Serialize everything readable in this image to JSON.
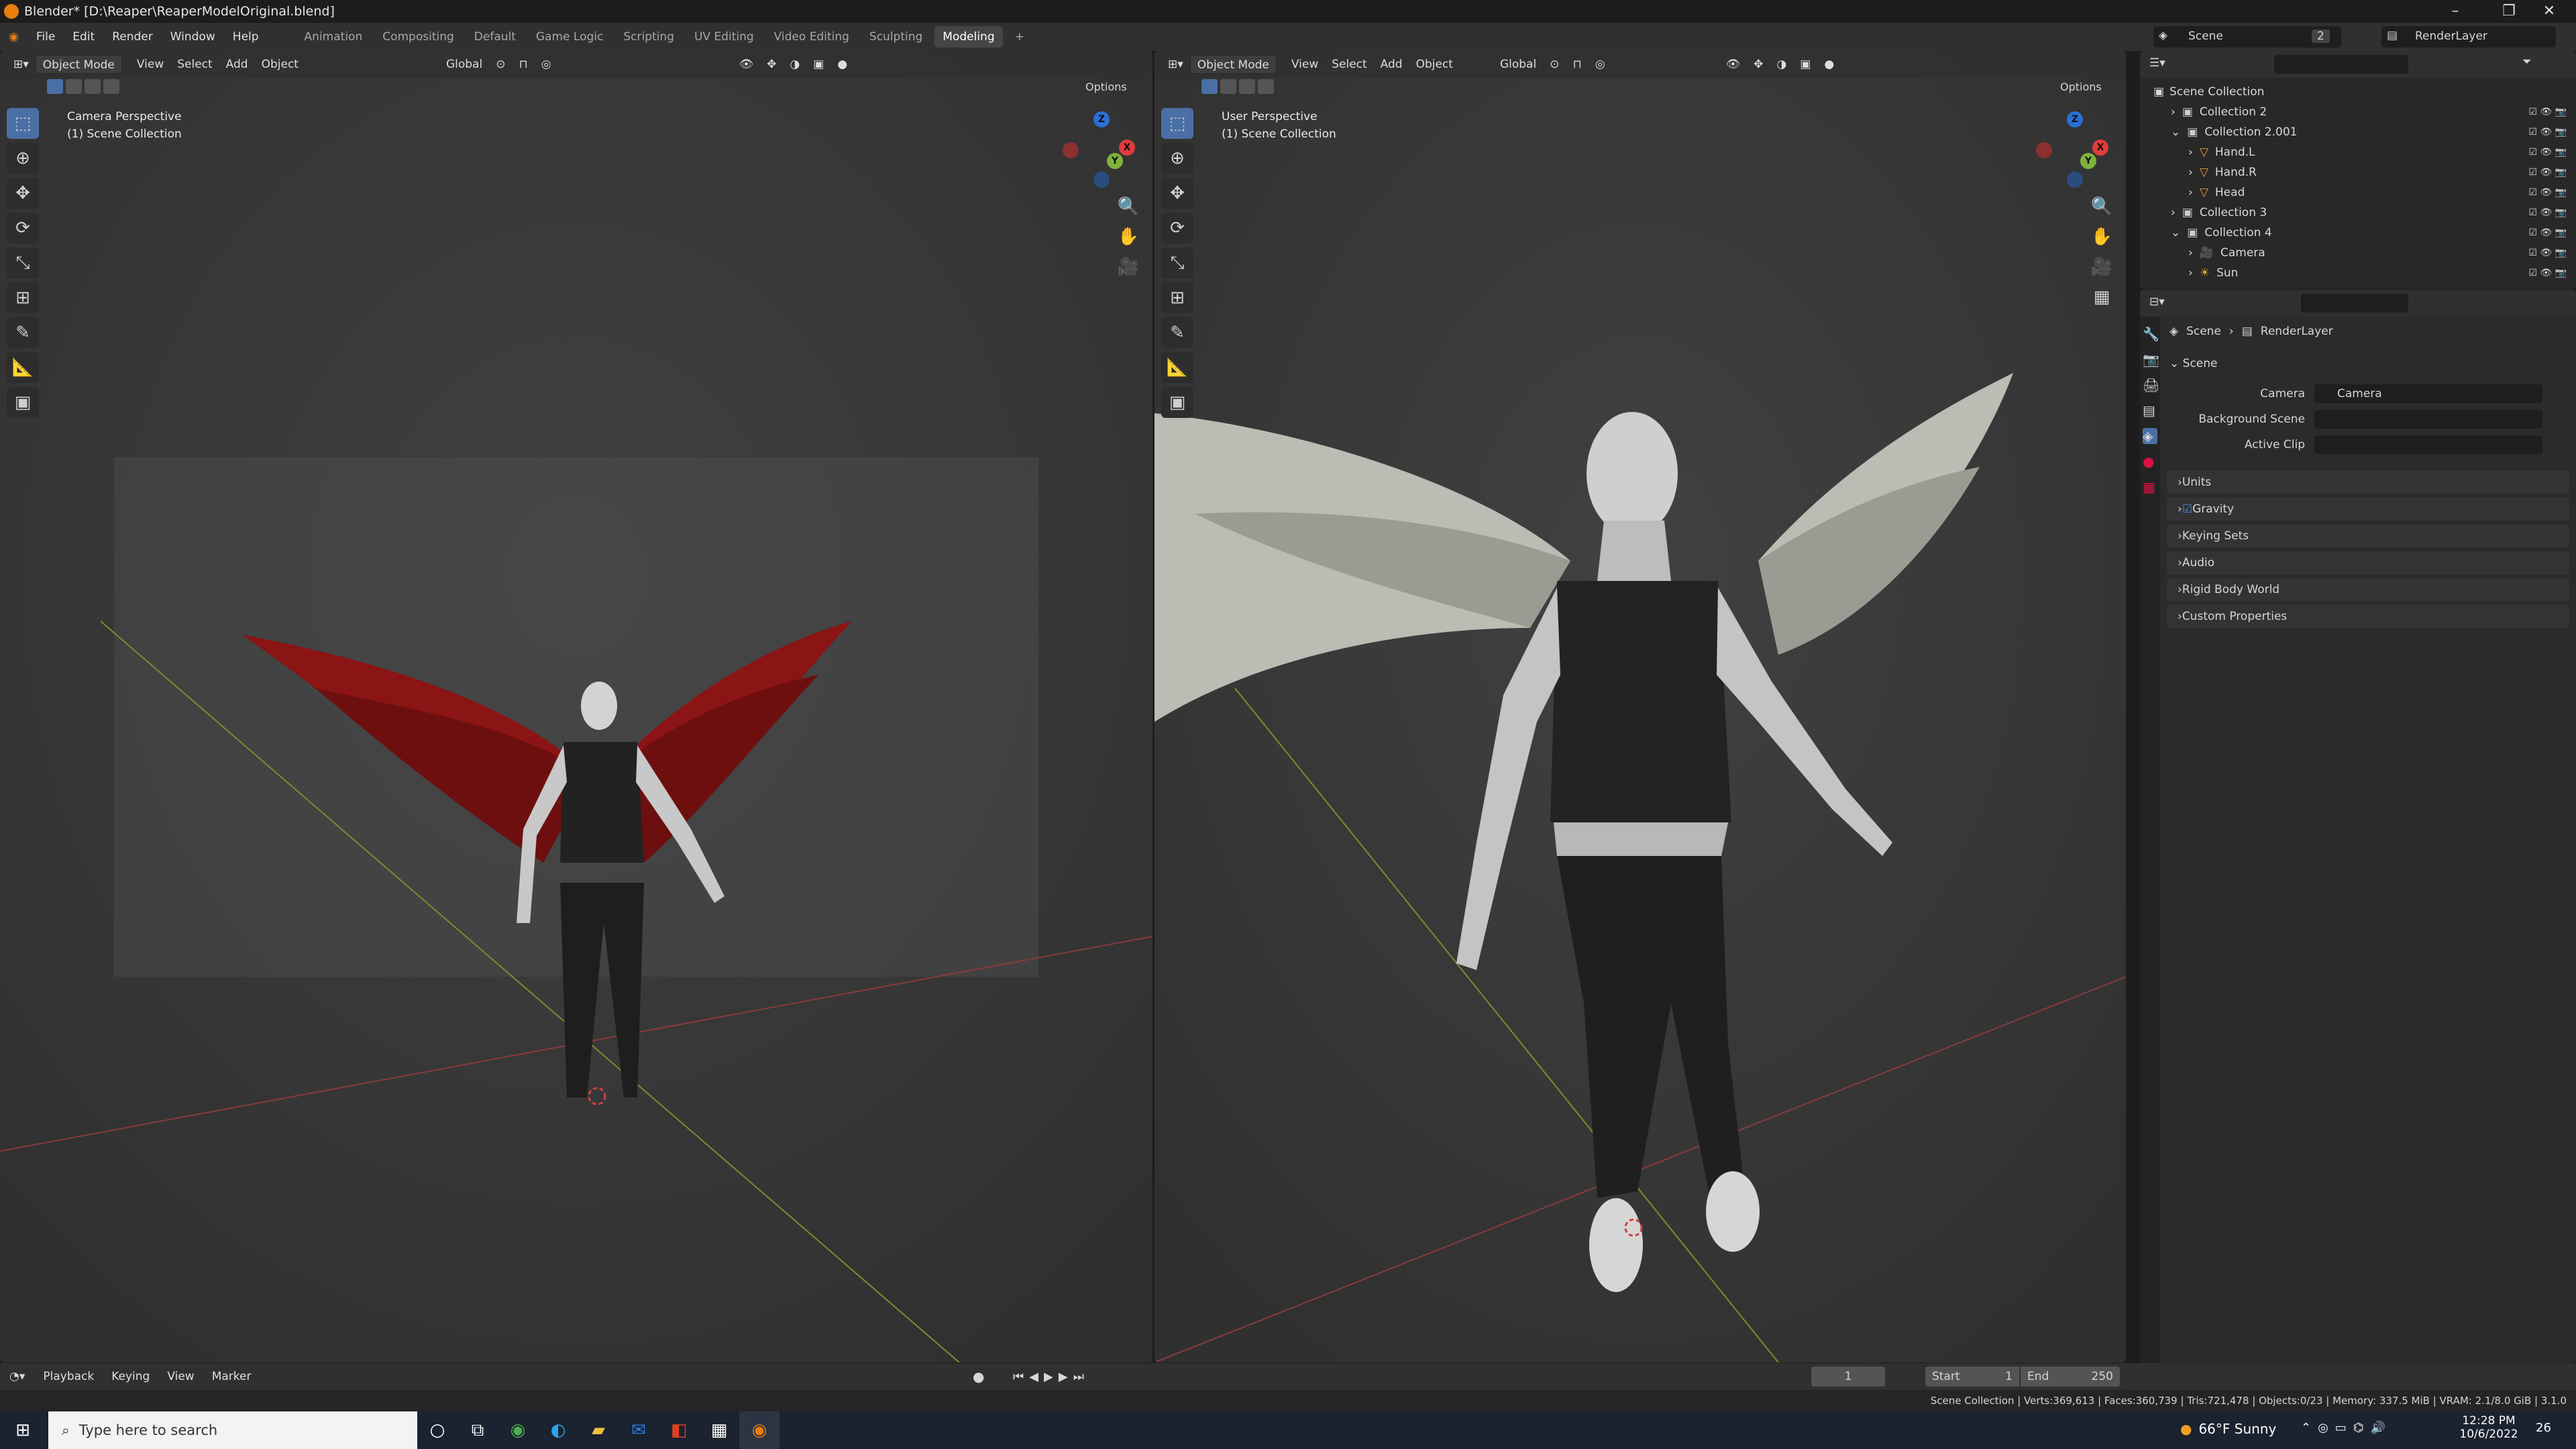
{
  "window": {
    "title": "Blender* [D:\\Reaper\\ReaperModelOriginal.blend]"
  },
  "menus": [
    "File",
    "Edit",
    "Render",
    "Window",
    "Help"
  ],
  "workspaces": [
    "Animation",
    "Compositing",
    "Default",
    "Game Logic",
    "Scripting",
    "UV Editing",
    "Video Editing",
    "Sculpting",
    "Modeling"
  ],
  "active_workspace": "Modeling",
  "scene_selector": {
    "value": "Scene",
    "count": "2"
  },
  "layer_selector": {
    "value": "RenderLayer"
  },
  "viewport_left": {
    "mode": "Object Mode",
    "menus": [
      "View",
      "Select",
      "Add",
      "Object"
    ],
    "orientation": "Global",
    "options": "Options",
    "title": "Camera Perspective",
    "subtitle": "(1) Scene Collection"
  },
  "viewport_right": {
    "mode": "Object Mode",
    "menus": [
      "View",
      "Select",
      "Add",
      "Object"
    ],
    "orientation": "Global",
    "options": "Options",
    "title": "User Perspective",
    "subtitle": "(1) Scene Collection"
  },
  "outliner": {
    "root": "Scene Collection",
    "items": [
      {
        "label": "Collection 2",
        "depth": 1,
        "expanded": false
      },
      {
        "label": "Collection 2.001",
        "depth": 1,
        "expanded": true
      },
      {
        "label": "Hand.L",
        "depth": 2
      },
      {
        "label": "Hand.R",
        "depth": 2
      },
      {
        "label": "Head",
        "depth": 2
      },
      {
        "label": "Collection 3",
        "depth": 1,
        "expanded": false
      },
      {
        "label": "Collection 4",
        "depth": 1,
        "expanded": true
      },
      {
        "label": "Camera",
        "depth": 2
      },
      {
        "label": "Sun",
        "depth": 2
      }
    ]
  },
  "properties": {
    "breadcrumb": [
      "Scene",
      "RenderLayer"
    ],
    "section": "Scene",
    "fields": [
      {
        "label": "Camera",
        "value": "Camera"
      },
      {
        "label": "Background Scene",
        "value": ""
      },
      {
        "label": "Active Clip",
        "value": ""
      }
    ],
    "panels": [
      "Units",
      "Gravity",
      "Keying Sets",
      "Audio",
      "Rigid Body World",
      "Custom Properties"
    ],
    "gravity_checked": true
  },
  "timeline": {
    "menus": [
      "Playback",
      "Keying",
      "View",
      "Marker"
    ],
    "current_frame": "1",
    "start_label": "Start",
    "start": "1",
    "end_label": "End",
    "end": "250"
  },
  "statusbar": {
    "text": "Scene Collection | Verts:369,613 | Faces:360,739 | Tris:721,478 | Objects:0/23 | Memory: 337.5 MiB | VRAM: 2.1/8.0 GiB | 3.1.0"
  },
  "taskbar": {
    "search_placeholder": "Type here to search",
    "weather": "66°F Sunny",
    "time": "12:28 PM",
    "date": "10/6/2022",
    "notifications": "26"
  },
  "colors": {
    "accent": "#4a6fa5",
    "active_tab": "#454545",
    "wing_red": "#8b1414",
    "brand": "#e87d0d"
  }
}
